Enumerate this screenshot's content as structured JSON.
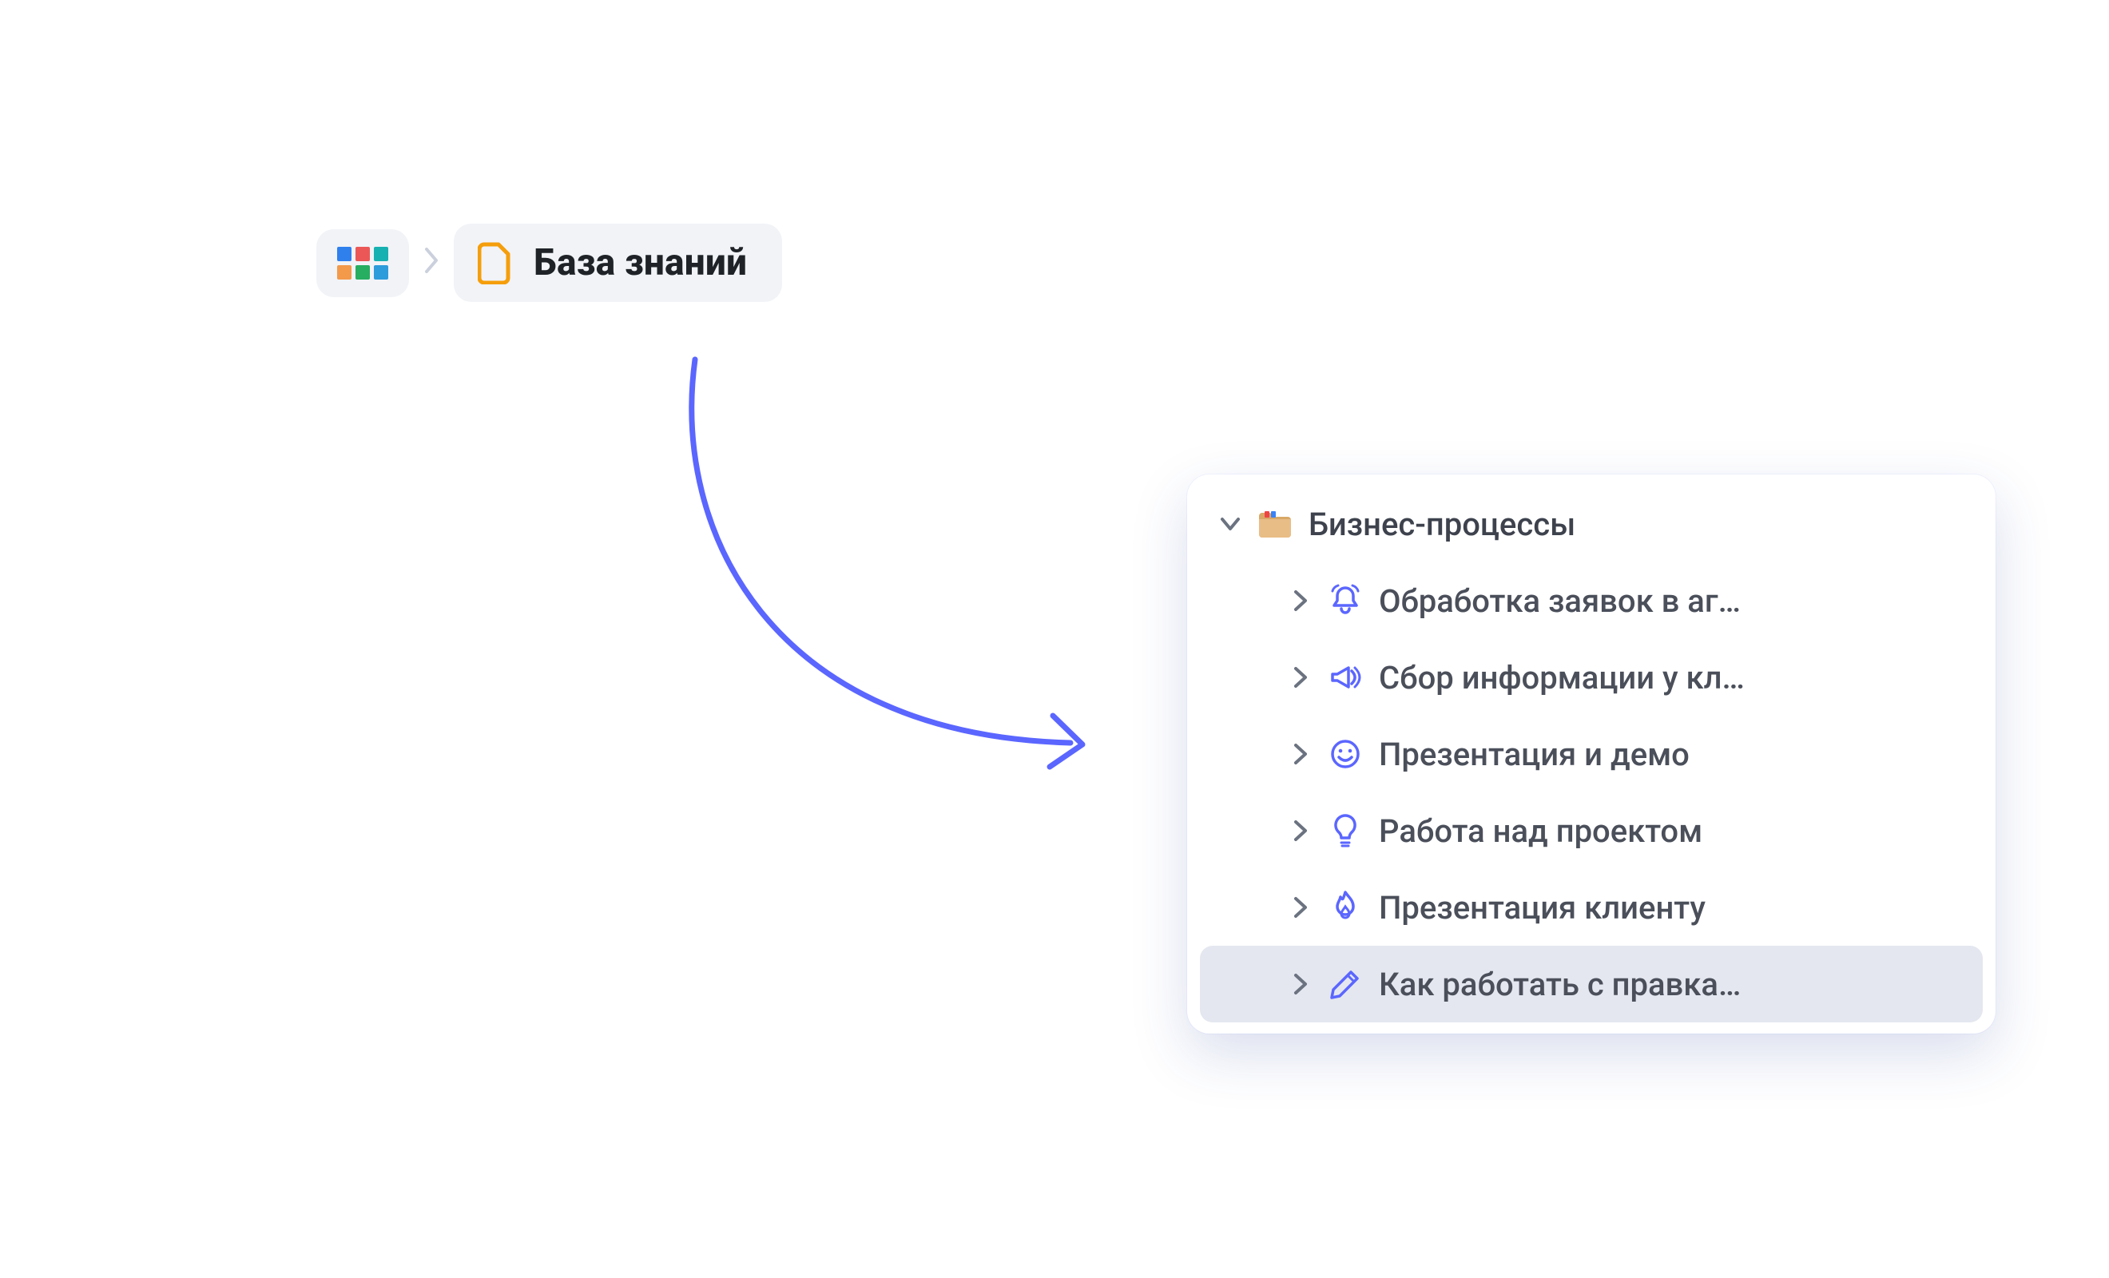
{
  "breadcrumb": {
    "apps_name": "apps",
    "kb_label": "База знаний"
  },
  "tree": {
    "group": {
      "label": "Бизнес-процессы",
      "icon": "folder-index"
    },
    "items": [
      {
        "label": "Обработка заявок в аг…",
        "icon": "bell",
        "selected": false
      },
      {
        "label": "Сбор информации у кл…",
        "icon": "megaphone",
        "selected": false
      },
      {
        "label": "Презентация и демо",
        "icon": "smile",
        "selected": false
      },
      {
        "label": "Работа над проектом",
        "icon": "lightbulb",
        "selected": false
      },
      {
        "label": "Презентация клиенту",
        "icon": "flame",
        "selected": false
      },
      {
        "label": "Как работать с правка…",
        "icon": "pencil",
        "selected": true
      }
    ]
  },
  "colors": {
    "accent": "#5b66ff",
    "ink": "#4a4f5a",
    "chip": "#f1f3f7"
  }
}
